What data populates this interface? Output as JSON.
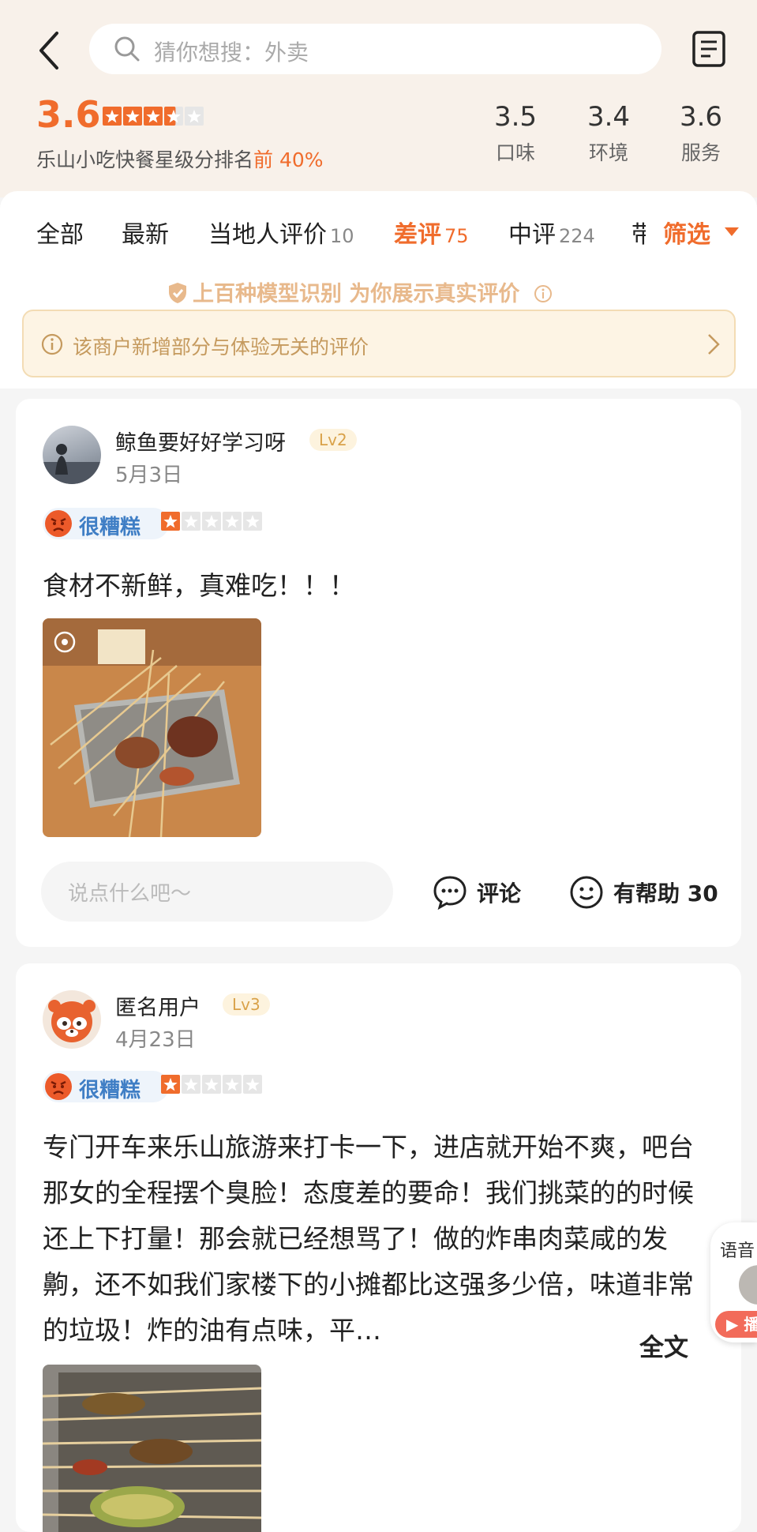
{
  "search": {
    "placeholder": "猜你想搜：外卖"
  },
  "summary": {
    "score": "3.6",
    "score_value": 3.6,
    "rank_prefix": "乐山小吃快餐星级分排名",
    "rank_highlight": "前 40%",
    "sub_scores": [
      {
        "value": "3.5",
        "label": "口味"
      },
      {
        "value": "3.4",
        "label": "环境"
      },
      {
        "value": "3.6",
        "label": "服务"
      }
    ]
  },
  "tabs": [
    {
      "label": "全部",
      "count": ""
    },
    {
      "label": "最新",
      "count": ""
    },
    {
      "label": "当地人评价",
      "count": "10"
    },
    {
      "label": "差评",
      "count": "75",
      "active": true
    },
    {
      "label": "中评",
      "count": "224"
    }
  ],
  "tab_partial": "带",
  "filter_label": "筛选",
  "verify_banner": "上百种模型识别 为你展示真实评价",
  "notice": "该商户新增部分与体验无关的评价",
  "reviews": [
    {
      "username": "鲸鱼要好好学习呀",
      "level": "Lv2",
      "date": "5月3日",
      "rating_label": "很糟糕",
      "stars": 1,
      "text": "食材不新鲜，真难吃！！！",
      "comment_placeholder": "说点什么吧～",
      "comment_label": "评论",
      "helpful_label": "有帮助",
      "helpful_count": "30"
    },
    {
      "username": "匿名用户",
      "level": "Lv3",
      "date": "4月23日",
      "rating_label": "很糟糕",
      "stars": 1,
      "text": "专门开车来乐山旅游来打卡一下，进店就开始不爽，吧台那女的全程摆个臭脸！态度差的要命！我们挑菜的的时候还上下打量！那会就已经想骂了！做的炸串肉菜咸的发齁，还不如我们家楼下的小摊都比这强多少倍，味道非常的垃圾！炸的油有点味，平…",
      "full_text_label": "全文"
    }
  ],
  "float_widget": {
    "label": "语音",
    "button": "▶ 播"
  },
  "colors": {
    "accent": "#f06c2c",
    "bad_rating": "#3f7ec5",
    "notice_bg": "#fdf4e4"
  }
}
